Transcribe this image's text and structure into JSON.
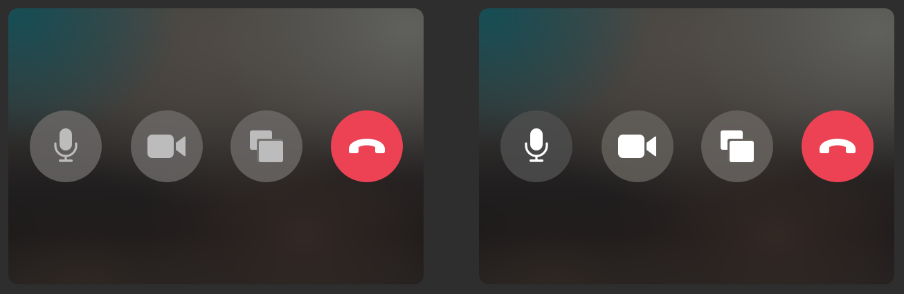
{
  "theme": {
    "page_background": "#2e2e2e",
    "end_call_color": "#ec4254"
  },
  "panels": [
    {
      "state": "disabled",
      "button_fill": "#686462",
      "icon_fill": "#bcbcbc",
      "buttons": [
        {
          "role": "microphone",
          "icon": "microphone-icon"
        },
        {
          "role": "camera",
          "icon": "video-camera-icon"
        },
        {
          "role": "screen-share",
          "icon": "screen-share-icon"
        },
        {
          "role": "end-call",
          "icon": "phone-hangup-icon"
        }
      ]
    },
    {
      "state": "enabled",
      "button_fill": "#5f5b58",
      "icon_fill": "#ffffff",
      "buttons": [
        {
          "role": "microphone",
          "icon": "microphone-icon"
        },
        {
          "role": "camera",
          "icon": "video-camera-icon"
        },
        {
          "role": "screen-share",
          "icon": "screen-share-icon"
        },
        {
          "role": "end-call",
          "icon": "phone-hangup-icon"
        }
      ]
    }
  ]
}
